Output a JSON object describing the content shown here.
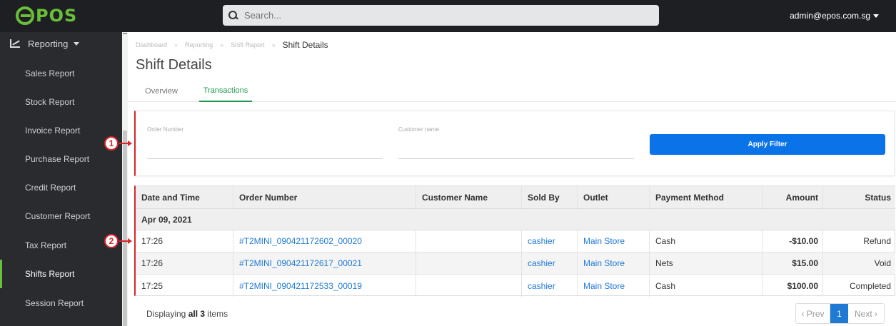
{
  "header": {
    "logo_text": "POS",
    "search_placeholder": "Search...",
    "user_email": "admin@epos.com.sg"
  },
  "sidebar": {
    "group_label": "Reporting",
    "items": [
      {
        "label": "Sales Report"
      },
      {
        "label": "Stock Report"
      },
      {
        "label": "Invoice Report"
      },
      {
        "label": "Purchase Report"
      },
      {
        "label": "Credit Report"
      },
      {
        "label": "Customer Report"
      },
      {
        "label": "Tax Report"
      },
      {
        "label": "Shifts Report",
        "active": true
      },
      {
        "label": "Session Report"
      }
    ]
  },
  "breadcrumb": {
    "items": [
      "Dashboard",
      "Reporting",
      "Shift Report"
    ],
    "current": "Shift Details"
  },
  "page_title": "Shift Details",
  "tabs": [
    {
      "label": "Overview",
      "active": false
    },
    {
      "label": "Transactions",
      "active": true
    }
  ],
  "filters": {
    "order_number_label": "Order Number",
    "order_number_value": "",
    "customer_name_label": "Customer name",
    "customer_name_value": "",
    "apply_label": "Apply Filter"
  },
  "markers": [
    "1",
    "2"
  ],
  "table": {
    "columns": [
      "Date and Time",
      "Order Number",
      "Customer Name",
      "Sold By",
      "Outlet",
      "Payment Method",
      "Amount",
      "Status"
    ],
    "group_label": "Apr 09, 2021",
    "rows": [
      {
        "time": "17:26",
        "order": "#T2MINI_090421172602_00020",
        "customer": "",
        "sold_by": "cashier",
        "outlet": "Main Store",
        "payment": "Cash",
        "amount": "-$10.00",
        "status": "Refund"
      },
      {
        "time": "17:26",
        "order": "#T2MINI_090421172617_00021",
        "customer": "",
        "sold_by": "cashier",
        "outlet": "Main Store",
        "payment": "Nets",
        "amount": "$15.00",
        "status": "Void"
      },
      {
        "time": "17:25",
        "order": "#T2MINI_090421172533_00019",
        "customer": "",
        "sold_by": "cashier",
        "outlet": "Main Store",
        "payment": "Cash",
        "amount": "$100.00",
        "status": "Completed"
      }
    ]
  },
  "footer": {
    "display_prefix": "Displaying",
    "display_count": "all 3",
    "display_suffix": "items",
    "prev_label": "‹ Prev",
    "page_number": "1",
    "next_label": "Next ›"
  },
  "colors": {
    "accent_green": "#6abf3a",
    "primary_blue": "#0a73e8",
    "link_blue": "#1f7ad6",
    "annotation_red": "#d9252b"
  }
}
